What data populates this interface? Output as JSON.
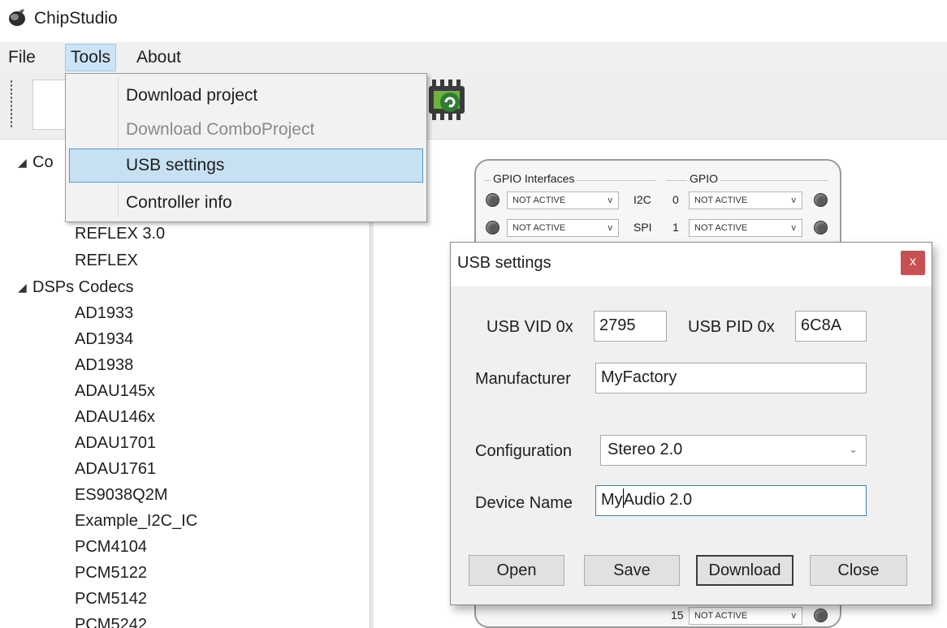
{
  "window": {
    "title": "ChipStudio",
    "icon": "app-logo-icon"
  },
  "menubar": {
    "items": [
      "File",
      "Tools",
      "About"
    ]
  },
  "tools_menu": {
    "items": [
      {
        "label": "Download project",
        "enabled": true
      },
      {
        "label": "Download ComboProject",
        "enabled": false
      },
      {
        "label": "USB settings",
        "enabled": true,
        "highlighted": true
      },
      {
        "label": "Controller info",
        "enabled": true
      }
    ]
  },
  "toolbar": {
    "icons": [
      "new-project-icon",
      "chip-controller-icon"
    ]
  },
  "tree": {
    "group1_label_partial": "Co",
    "group1_items": [
      "REFLEX 3.0",
      "REFLEX"
    ],
    "group2_label": "DSPs Codecs",
    "group2_items": [
      "AD1933",
      "AD1934",
      "AD1938",
      "ADAU145x",
      "ADAU146x",
      "ADAU1701",
      "ADAU1761",
      "ES9038Q2M",
      "Example_I2C_IC",
      "PCM4104",
      "PCM5122",
      "PCM5142",
      "PCM5242"
    ]
  },
  "gpio_block": {
    "interfaces_label": "GPIO Interfaces",
    "gpio_label": "GPIO",
    "rows": [
      {
        "iface_value": "NOT ACTIVE",
        "iface_name": "I2C",
        "gpio_index": "0",
        "gpio_value": "NOT ACTIVE"
      },
      {
        "iface_value": "NOT ACTIVE",
        "iface_name": "SPI",
        "gpio_index": "1",
        "gpio_value": "NOT ACTIVE"
      }
    ],
    "bottom_row": {
      "gpio_index": "15",
      "gpio_value": "NOT ACTIVE"
    }
  },
  "usb_dialog": {
    "title": "USB settings",
    "close_glyph": "x",
    "vid_label": "USB VID  0x",
    "vid_value": "2795",
    "pid_label": "USB PID  0x",
    "pid_value": "6C8A",
    "manufacturer_label": "Manufacturer",
    "manufacturer_value": "MyFactory",
    "configuration_label": "Configuration",
    "configuration_value": "Stereo 2.0",
    "device_name_label": "Device Name",
    "device_name_before_caret": "My",
    "device_name_after_caret": "Audio 2.0",
    "buttons": {
      "open": "Open",
      "save": "Save",
      "download": "Download",
      "close": "Close"
    }
  }
}
